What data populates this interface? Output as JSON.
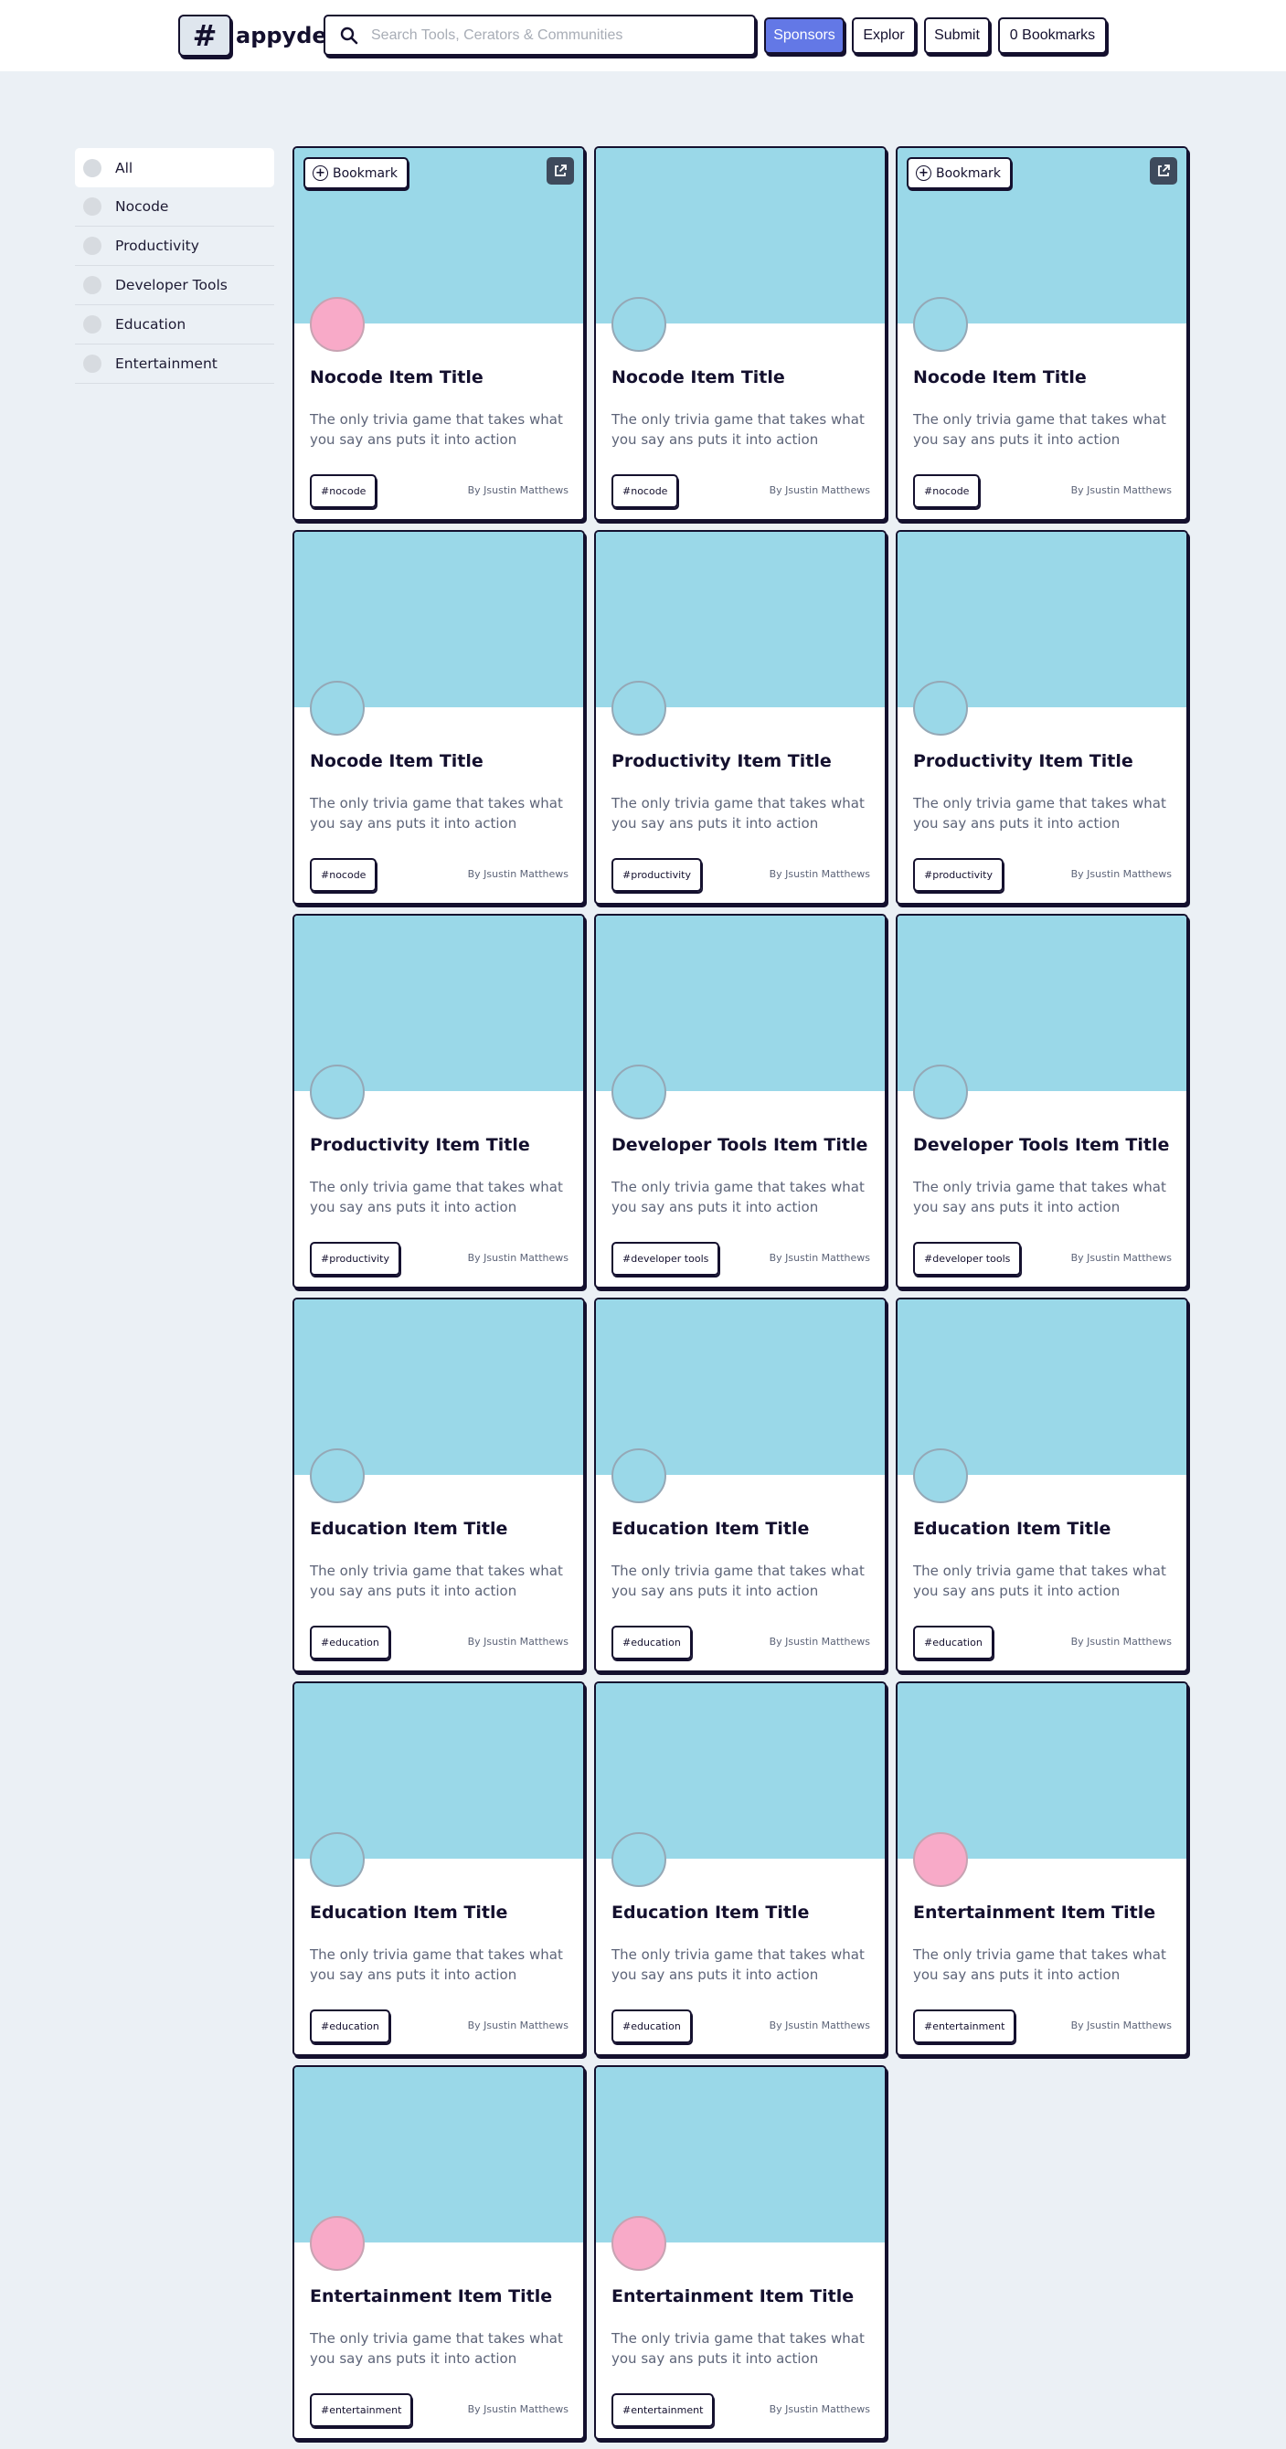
{
  "header": {
    "logo_mark": "#",
    "logo_text": "appydev",
    "search_placeholder": "Search Tools, Cerators & Communities",
    "sponsors_label": "Sponsors",
    "explore_label": "Explor",
    "submit_label": "Submit",
    "bookmarks_count": "0",
    "bookmarks_label": "Bookmarks"
  },
  "sidebar": {
    "items": [
      {
        "label": "All"
      },
      {
        "label": "Nocode"
      },
      {
        "label": "Productivity"
      },
      {
        "label": "Developer Tools"
      },
      {
        "label": "Education"
      },
      {
        "label": "Entertainment"
      }
    ]
  },
  "card_common": {
    "bookmark_label": "Bookmark",
    "description": "The only trivia game that takes what you say ans puts it into action",
    "author": "By Jsustin Matthews"
  },
  "cards": [
    {
      "title": "Nocode Item Title",
      "tag": "#nocode",
      "avatar": "pink",
      "bookmark": true
    },
    {
      "title": "Nocode Item Title",
      "tag": "#nocode",
      "avatar": "blue",
      "bookmark": false
    },
    {
      "title": "Nocode Item Title",
      "tag": "#nocode",
      "avatar": "blue",
      "bookmark": true
    },
    {
      "title": "Nocode Item Title",
      "tag": "#nocode",
      "avatar": "blue",
      "bookmark": false
    },
    {
      "title": "Productivity Item Title",
      "tag": "#productivity",
      "avatar": "blue",
      "bookmark": false
    },
    {
      "title": "Productivity Item Title",
      "tag": "#productivity",
      "avatar": "blue",
      "bookmark": false
    },
    {
      "title": "Productivity Item Title",
      "tag": "#productivity",
      "avatar": "blue",
      "bookmark": false
    },
    {
      "title": "Developer Tools Item Title",
      "tag": "#developer tools",
      "avatar": "blue",
      "bookmark": false
    },
    {
      "title": "Developer Tools Item Title",
      "tag": "#developer tools",
      "avatar": "blue",
      "bookmark": false
    },
    {
      "title": "Education Item Title",
      "tag": "#education",
      "avatar": "blue",
      "bookmark": false
    },
    {
      "title": "Education Item Title",
      "tag": "#education",
      "avatar": "blue",
      "bookmark": false
    },
    {
      "title": "Education Item Title",
      "tag": "#education",
      "avatar": "blue",
      "bookmark": false
    },
    {
      "title": "Education Item Title",
      "tag": "#education",
      "avatar": "blue",
      "bookmark": false
    },
    {
      "title": "Education Item Title",
      "tag": "#education",
      "avatar": "blue",
      "bookmark": false
    },
    {
      "title": "Entertainment Item Title",
      "tag": "#entertainment",
      "avatar": "pink",
      "bookmark": false
    },
    {
      "title": "Entertainment Item Title",
      "tag": "#entertainment",
      "avatar": "pink",
      "bookmark": false
    },
    {
      "title": "Entertainment Item Title",
      "tag": "#entertainment",
      "avatar": "pink",
      "bookmark": false
    }
  ],
  "colors": {
    "background": "#ebf0f5",
    "banner": "#9ad8e8",
    "avatar_pink": "#f8aac8",
    "accent": "#6378e6",
    "ink": "#14102e"
  }
}
